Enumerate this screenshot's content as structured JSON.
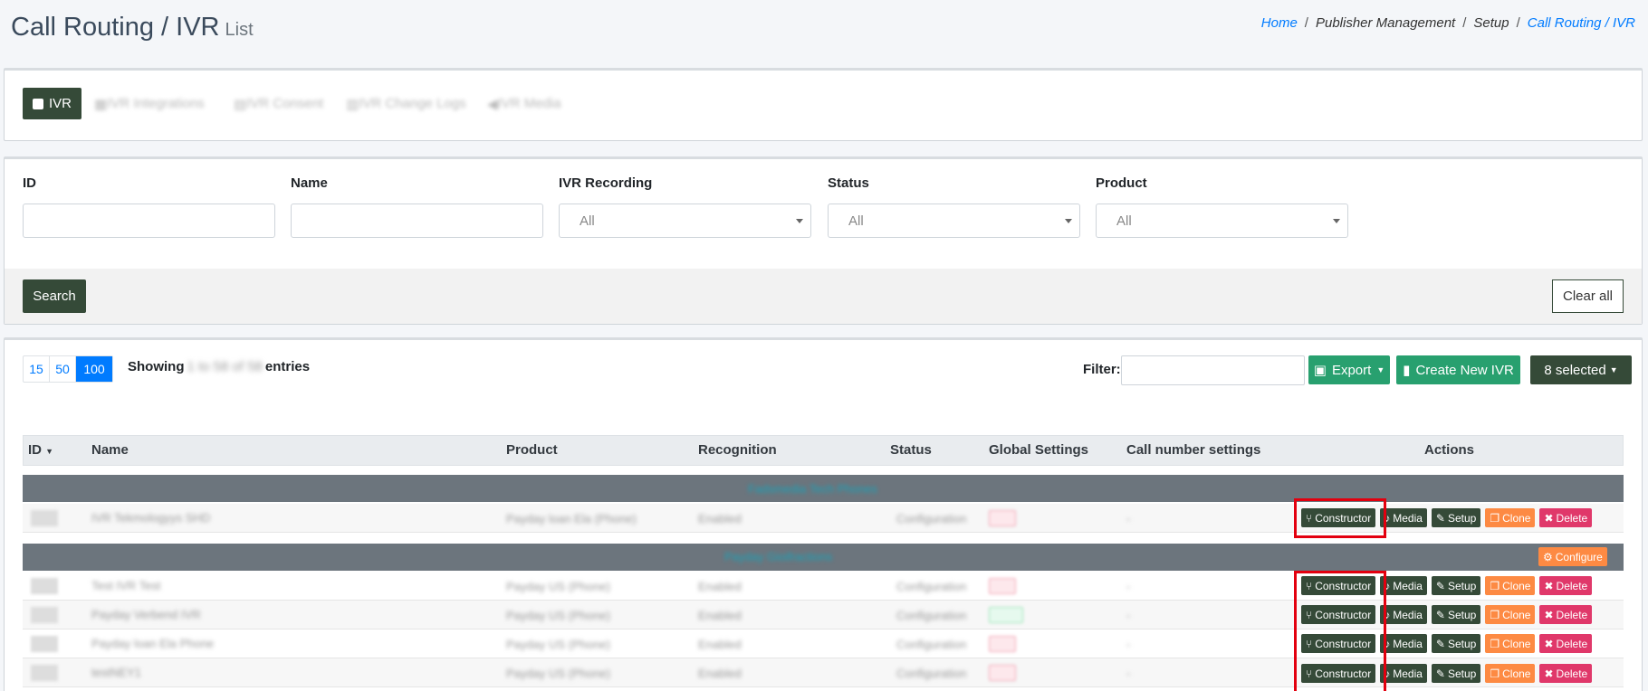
{
  "header": {
    "title": "Call Routing / IVR",
    "subtitle": "List",
    "breadcrumb": [
      "Home",
      "Publisher Management",
      "Setup",
      "Call Routing / IVR"
    ]
  },
  "tabs": {
    "active": "IVR",
    "others": [
      "IVR Integrations",
      "IVR Consent",
      "IVR Change Logs",
      "IVR Media"
    ]
  },
  "filters": {
    "id_label": "ID",
    "name_label": "Name",
    "recording_label": "IVR Recording",
    "recording_value": "All",
    "status_label": "Status",
    "status_value": "All",
    "product_label": "Product",
    "product_value": "All",
    "search_button": "Search",
    "clear_button": "Clear all"
  },
  "table_controls": {
    "page_sizes": [
      "15",
      "50",
      "100"
    ],
    "active_page_size": "100",
    "showing_prefix": "Showing",
    "showing_range": "1 to 58 of 58",
    "showing_suffix": "entries",
    "filter_label": "Filter:",
    "export_button": "Export",
    "create_button": "Create New IVR",
    "selected_button": "8 selected"
  },
  "columns": [
    "ID",
    "Name",
    "Product",
    "Recognition",
    "Status",
    "Global Settings",
    "Call number settings",
    "Actions"
  ],
  "groups": [
    {
      "title": "Fadsmedia Tech Phones",
      "configure": null,
      "rows": [
        {
          "name": "IVR Tekmologyys SHD",
          "product": "Payday loan Ela (Phone)",
          "recognition": "Enabled",
          "status": "Configuration",
          "global": "Off",
          "global_on": false,
          "call_number": "-"
        }
      ]
    },
    {
      "title": "Payday Gioifractions",
      "configure": "Configure",
      "rows": [
        {
          "name": "Test IVR Test",
          "product": "Payday US (Phone)",
          "recognition": "Enabled",
          "status": "Configuration",
          "global": "Off",
          "global_on": false,
          "call_number": "-"
        },
        {
          "name": "Payday Verbend IVR",
          "product": "Payday US (Phone)",
          "recognition": "Enabled",
          "status": "Configuration",
          "global": "Yes",
          "global_on": true,
          "call_number": "-"
        },
        {
          "name": "Payday loan Ela Phone",
          "product": "Payday US (Phone)",
          "recognition": "Enabled",
          "status": "Configuration",
          "global": "Off",
          "global_on": false,
          "call_number": "-"
        },
        {
          "name": "testNEY1",
          "product": "Payday US (Phone)",
          "recognition": "Enabled",
          "status": "Configuration",
          "global": "Off",
          "global_on": false,
          "call_number": "-"
        }
      ]
    }
  ],
  "actions": {
    "constructor": "Constructor",
    "media": "Media",
    "setup": "Setup",
    "clone": "Clone",
    "delete": "Delete"
  },
  "colors": {
    "primary_dark": "#354a38",
    "success": "#28a06f",
    "warning": "#fd8a43",
    "danger": "#e0386a",
    "link": "#007bff",
    "highlight": "#e3000f"
  }
}
